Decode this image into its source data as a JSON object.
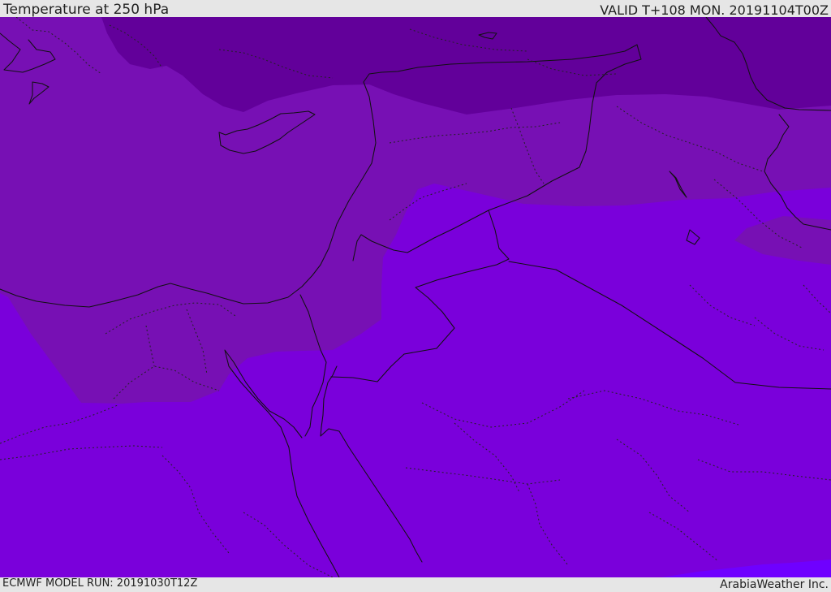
{
  "header": {
    "title": "Temperature at 250 hPa",
    "valid": "VALID T+108 MON. 20191104T00Z"
  },
  "footer": {
    "model_run": "ECMWF MODEL RUN: 20191030T12Z",
    "credit": "ArabiaWeather Inc."
  },
  "colors": {
    "coldest": "#62009a",
    "cold": "#7710b4",
    "mid": "#7a00db",
    "warm": "#6f00ff",
    "border": "#111111"
  }
}
